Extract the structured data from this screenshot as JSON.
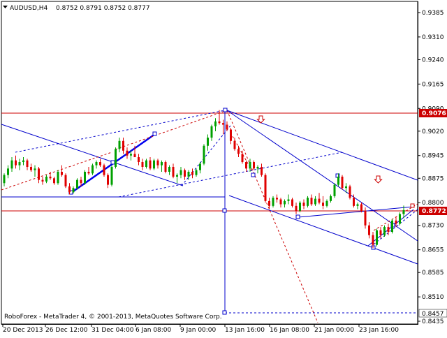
{
  "header": {
    "symbol": "AUDUSD,H4",
    "ohlc": "0.8752 0.8791 0.8752 0.8777"
  },
  "footer": {
    "copyright": "RoboForex - MetaTrader 4, © 2001-2013, MetaQuotes Software Corp."
  },
  "colors": {
    "bullish": "#00a000",
    "bearish": "#e00000",
    "trendline": "#0000cc",
    "level": "#cc0000",
    "price_tag_bg": "#cc0000"
  },
  "icons": {
    "timeframe_dropdown": "triangle-down-icon",
    "down_arrow": "hollow-down-arrow-icon"
  },
  "price_axis": {
    "ticks": [
      "0.9385",
      "0.9310",
      "0.9240",
      "0.9165",
      "0.9090",
      "0.9020",
      "0.8945",
      "0.8875",
      "0.8800",
      "0.8730",
      "0.8655",
      "0.8585",
      "0.8510",
      "0.8435"
    ],
    "tags": [
      "0.9076",
      "0.8772",
      "0.8457"
    ]
  },
  "time_axis": {
    "labels": [
      "20 Dec 2013",
      "26 Dec 12:00",
      "31 Dec 04:00",
      "6 Jan 08:00",
      "9 Jan 00:00",
      "13 Jan 16:00",
      "16 Jan 08:00",
      "21 Jan 00:00",
      "23 Jan 16:00"
    ]
  },
  "chart_data": {
    "type": "candlestick",
    "symbol": "AUDUSD",
    "timeframe": "H4",
    "horizontal_levels": [
      0.9076,
      0.8772,
      0.8813
    ],
    "vertical_marker_time": "13 Jan 16:00",
    "candles": [
      [
        0.886,
        0.889,
        0.885,
        0.8885
      ],
      [
        0.8885,
        0.8915,
        0.8875,
        0.8905
      ],
      [
        0.8905,
        0.894,
        0.8895,
        0.893
      ],
      [
        0.893,
        0.8945,
        0.8905,
        0.8915
      ],
      [
        0.8915,
        0.8935,
        0.89,
        0.8925
      ],
      [
        0.8925,
        0.894,
        0.8915,
        0.893
      ],
      [
        0.893,
        0.8935,
        0.89,
        0.891
      ],
      [
        0.891,
        0.892,
        0.8895,
        0.89
      ],
      [
        0.89,
        0.8915,
        0.888,
        0.8905
      ],
      [
        0.8905,
        0.891,
        0.886,
        0.887
      ],
      [
        0.887,
        0.888,
        0.8855,
        0.8865
      ],
      [
        0.8865,
        0.8885,
        0.886,
        0.888
      ],
      [
        0.888,
        0.8895,
        0.887,
        0.8875
      ],
      [
        0.8875,
        0.888,
        0.8855,
        0.886
      ],
      [
        0.886,
        0.89,
        0.8855,
        0.8895
      ],
      [
        0.8895,
        0.8915,
        0.888,
        0.8885
      ],
      [
        0.8885,
        0.889,
        0.8845,
        0.885
      ],
      [
        0.885,
        0.886,
        0.8825,
        0.8832
      ],
      [
        0.8832,
        0.885,
        0.8828,
        0.8845
      ],
      [
        0.8845,
        0.8875,
        0.884,
        0.887
      ],
      [
        0.887,
        0.888,
        0.885,
        0.886
      ],
      [
        0.886,
        0.89,
        0.8855,
        0.8895
      ],
      [
        0.8895,
        0.891,
        0.8885,
        0.889
      ],
      [
        0.889,
        0.892,
        0.8885,
        0.8915
      ],
      [
        0.8915,
        0.893,
        0.8905,
        0.8925
      ],
      [
        0.8925,
        0.8935,
        0.891,
        0.8915
      ],
      [
        0.8915,
        0.892,
        0.888,
        0.8885
      ],
      [
        0.8885,
        0.889,
        0.8845,
        0.8855
      ],
      [
        0.8855,
        0.8915,
        0.885,
        0.891
      ],
      [
        0.891,
        0.897,
        0.8905,
        0.8965
      ],
      [
        0.8965,
        0.9,
        0.8955,
        0.899
      ],
      [
        0.899,
        0.9,
        0.895,
        0.896
      ],
      [
        0.896,
        0.897,
        0.8935,
        0.8945
      ],
      [
        0.8945,
        0.896,
        0.893,
        0.895
      ],
      [
        0.895,
        0.8975,
        0.894,
        0.894
      ],
      [
        0.894,
        0.895,
        0.8915,
        0.8925
      ],
      [
        0.8925,
        0.8935,
        0.89,
        0.891
      ],
      [
        0.891,
        0.8935,
        0.8905,
        0.893
      ],
      [
        0.893,
        0.894,
        0.89,
        0.8905
      ],
      [
        0.8905,
        0.8935,
        0.89,
        0.893
      ],
      [
        0.893,
        0.8935,
        0.8905,
        0.8915
      ],
      [
        0.8915,
        0.893,
        0.8895,
        0.8925
      ],
      [
        0.8925,
        0.893,
        0.889,
        0.8895
      ],
      [
        0.8895,
        0.8915,
        0.8885,
        0.891
      ],
      [
        0.891,
        0.892,
        0.8875,
        0.888
      ],
      [
        0.888,
        0.889,
        0.886,
        0.8885
      ],
      [
        0.8885,
        0.891,
        0.8875,
        0.89
      ],
      [
        0.89,
        0.8905,
        0.887,
        0.888
      ],
      [
        0.888,
        0.89,
        0.887,
        0.8895
      ],
      [
        0.8895,
        0.8905,
        0.8875,
        0.8885
      ],
      [
        0.8885,
        0.8905,
        0.888,
        0.89
      ],
      [
        0.89,
        0.8925,
        0.889,
        0.892
      ],
      [
        0.892,
        0.898,
        0.8915,
        0.8975
      ],
      [
        0.8975,
        0.901,
        0.896,
        0.9
      ],
      [
        0.9,
        0.904,
        0.899,
        0.9035
      ],
      [
        0.9035,
        0.906,
        0.902,
        0.905
      ],
      [
        0.905,
        0.9085,
        0.904,
        0.9045
      ],
      [
        0.9045,
        0.9055,
        0.901,
        0.904
      ],
      [
        0.904,
        0.905,
        0.902,
        0.9025
      ],
      [
        0.9025,
        0.903,
        0.898,
        0.899
      ],
      [
        0.899,
        0.9,
        0.896,
        0.8965
      ],
      [
        0.8965,
        0.8975,
        0.894,
        0.895
      ],
      [
        0.895,
        0.896,
        0.892,
        0.8925
      ],
      [
        0.8925,
        0.893,
        0.8895,
        0.8905
      ],
      [
        0.8905,
        0.8935,
        0.8895,
        0.8925
      ],
      [
        0.8925,
        0.893,
        0.89,
        0.8905
      ],
      [
        0.8905,
        0.8915,
        0.889,
        0.891
      ],
      [
        0.891,
        0.892,
        0.888,
        0.8885
      ],
      [
        0.8885,
        0.889,
        0.88,
        0.8805
      ],
      [
        0.8805,
        0.8815,
        0.878,
        0.879
      ],
      [
        0.879,
        0.882,
        0.8785,
        0.8815
      ],
      [
        0.8815,
        0.8825,
        0.88,
        0.881
      ],
      [
        0.881,
        0.8815,
        0.8785,
        0.8795
      ],
      [
        0.8795,
        0.881,
        0.8785,
        0.8805
      ],
      [
        0.8805,
        0.8825,
        0.8795,
        0.881
      ],
      [
        0.881,
        0.8815,
        0.8785,
        0.879
      ],
      [
        0.879,
        0.88,
        0.8765,
        0.8775
      ],
      [
        0.8775,
        0.8805,
        0.877,
        0.88
      ],
      [
        0.88,
        0.881,
        0.878,
        0.879
      ],
      [
        0.879,
        0.882,
        0.8785,
        0.8815
      ],
      [
        0.8815,
        0.8825,
        0.879,
        0.8795
      ],
      [
        0.8795,
        0.882,
        0.879,
        0.8812
      ],
      [
        0.8812,
        0.883,
        0.8795,
        0.88
      ],
      [
        0.88,
        0.882,
        0.878,
        0.879
      ],
      [
        0.879,
        0.881,
        0.8785,
        0.8805
      ],
      [
        0.8805,
        0.8825,
        0.88,
        0.882
      ],
      [
        0.882,
        0.886,
        0.8815,
        0.8855
      ],
      [
        0.8855,
        0.889,
        0.885,
        0.888
      ],
      [
        0.888,
        0.8885,
        0.884,
        0.8845
      ],
      [
        0.8845,
        0.886,
        0.883,
        0.885
      ],
      [
        0.885,
        0.8855,
        0.881,
        0.8815
      ],
      [
        0.8815,
        0.8825,
        0.8785,
        0.879
      ],
      [
        0.879,
        0.88,
        0.878,
        0.8795
      ],
      [
        0.8795,
        0.88,
        0.877,
        0.8775
      ],
      [
        0.8775,
        0.8785,
        0.872,
        0.873
      ],
      [
        0.873,
        0.874,
        0.869,
        0.87
      ],
      [
        0.87,
        0.871,
        0.866,
        0.867
      ],
      [
        0.867,
        0.872,
        0.8665,
        0.8715
      ],
      [
        0.8715,
        0.8725,
        0.869,
        0.87
      ],
      [
        0.87,
        0.873,
        0.8695,
        0.8725
      ],
      [
        0.8725,
        0.8735,
        0.87,
        0.871
      ],
      [
        0.871,
        0.875,
        0.8705,
        0.8745
      ],
      [
        0.8745,
        0.8755,
        0.8725,
        0.8735
      ],
      [
        0.8735,
        0.877,
        0.873,
        0.8765
      ],
      [
        0.8765,
        0.8791,
        0.8752,
        0.8777
      ]
    ]
  }
}
